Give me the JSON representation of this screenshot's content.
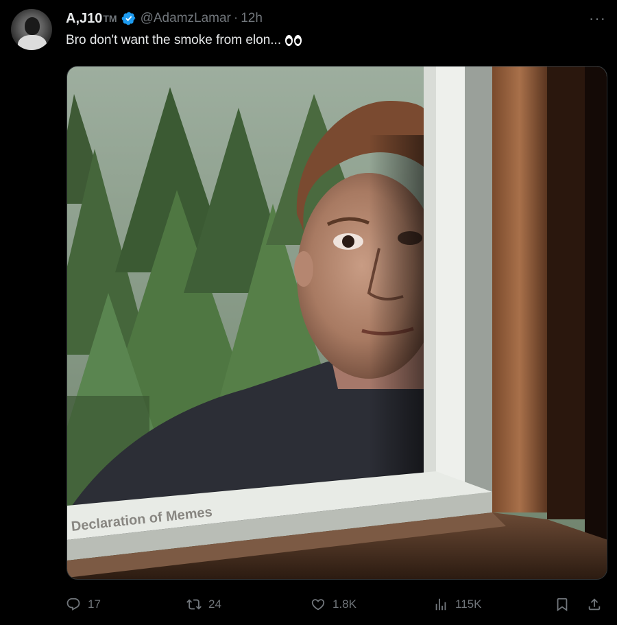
{
  "post": {
    "display_name": "A,J10",
    "tm": "TM",
    "handle": "@AdamzLamar",
    "separator": "·",
    "time": "12h",
    "text": "Bro don't want the smoke from elon...",
    "text_emoji": "eyes-emoji",
    "more_label": "···"
  },
  "media": {
    "watermark": "Declaration of Memes"
  },
  "actions": {
    "reply_count": "17",
    "retweet_count": "24",
    "like_count": "1.8K",
    "views_count": "115K"
  },
  "icons": [
    "verified-badge-icon",
    "more-icon",
    "reply-icon",
    "retweet-icon",
    "like-icon",
    "views-icon",
    "bookmark-icon",
    "share-icon"
  ],
  "colors": {
    "background": "#000000",
    "text_primary": "#e7e9ea",
    "text_secondary": "#71767b",
    "verified_blue": "#1d9bf0"
  }
}
